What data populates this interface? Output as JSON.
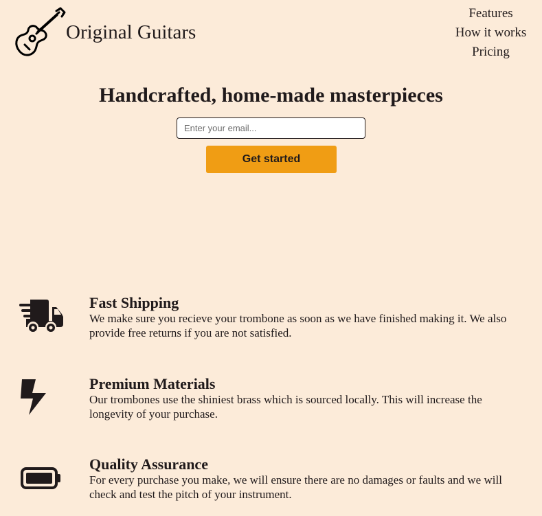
{
  "brand": {
    "name": "Original Guitars",
    "logo_icon": "guitar-icon"
  },
  "nav": {
    "items": [
      {
        "label": "Features"
      },
      {
        "label": "How it works"
      },
      {
        "label": "Pricing"
      }
    ]
  },
  "hero": {
    "title": "Handcrafted, home-made masterpieces",
    "email_placeholder": "Enter your email...",
    "email_value": "",
    "button_label": "Get started",
    "button_color": "#f09d14"
  },
  "features": [
    {
      "icon": "shipping-truck-icon",
      "title": "Fast Shipping",
      "description": "We make sure you recieve your trombone as soon as we have finished making it. We also provide free returns if you are not satisfied."
    },
    {
      "icon": "lightning-bolt-icon",
      "title": "Premium Materials",
      "description": "Our trombones use the shiniest brass which is sourced locally. This will increase the longevity of your purchase."
    },
    {
      "icon": "battery-full-icon",
      "title": "Quality Assurance",
      "description": "For every purchase you make, we will ensure there are no damages or faults and we will check and test the pitch of your instrument."
    }
  ],
  "colors": {
    "background": "#fcebd9",
    "text": "#201a1b",
    "accent": "#f09d14"
  }
}
